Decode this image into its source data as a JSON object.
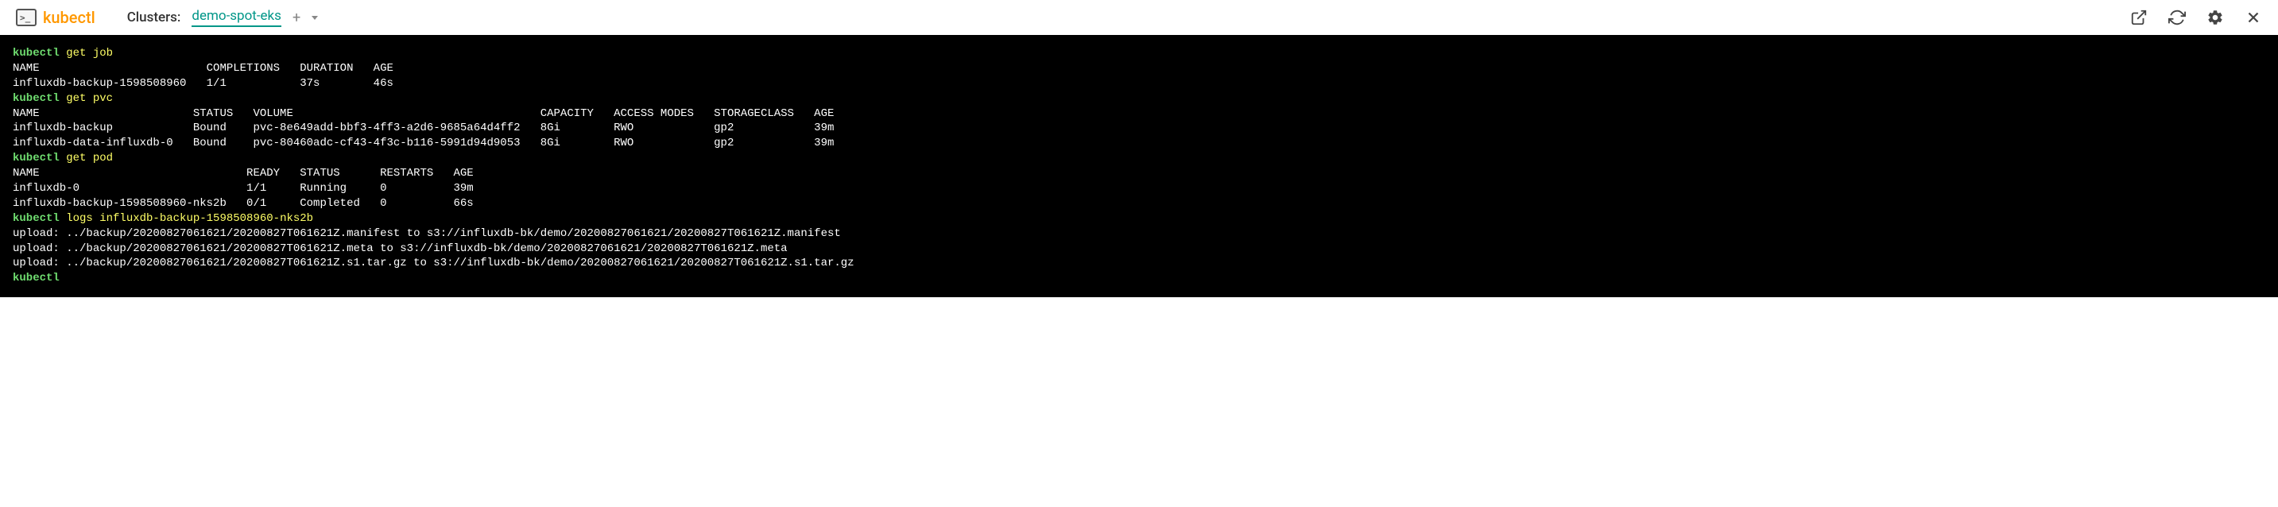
{
  "header": {
    "logo_text": "kubectl",
    "clusters_label": "Clusters:",
    "active_cluster": "demo-spot-eks",
    "add_glyph": "+"
  },
  "terminal": {
    "prompt": "kubectl",
    "cmd_job": "get job",
    "job_header": "NAME                         COMPLETIONS   DURATION   AGE",
    "job_row_0": "influxdb-backup-1598508960   1/1           37s        46s",
    "cmd_pvc": "get pvc",
    "pvc_header": "NAME                       STATUS   VOLUME                                     CAPACITY   ACCESS MODES   STORAGECLASS   AGE",
    "pvc_row_0": "influxdb-backup            Bound    pvc-8e649add-bbf3-4ff3-a2d6-9685a64d4ff2   8Gi        RWO            gp2            39m",
    "pvc_row_1": "influxdb-data-influxdb-0   Bound    pvc-80460adc-cf43-4f3c-b116-5991d94d9053   8Gi        RWO            gp2            39m",
    "cmd_pod": "get pod",
    "pod_header": "NAME                               READY   STATUS      RESTARTS   AGE",
    "pod_row_0": "influxdb-0                         1/1     Running     0          39m",
    "pod_row_1": "influxdb-backup-1598508960-nks2b   0/1     Completed   0          66s",
    "cmd_logs": "logs influxdb-backup-1598508960-nks2b",
    "log_0": "upload: ../backup/20200827061621/20200827T061621Z.manifest to s3://influxdb-bk/demo/20200827061621/20200827T061621Z.manifest",
    "log_1": "upload: ../backup/20200827061621/20200827T061621Z.meta to s3://influxdb-bk/demo/20200827061621/20200827T061621Z.meta",
    "log_2": "upload: ../backup/20200827061621/20200827T061621Z.s1.tar.gz to s3://influxdb-bk/demo/20200827061621/20200827T061621Z.s1.tar.gz"
  }
}
